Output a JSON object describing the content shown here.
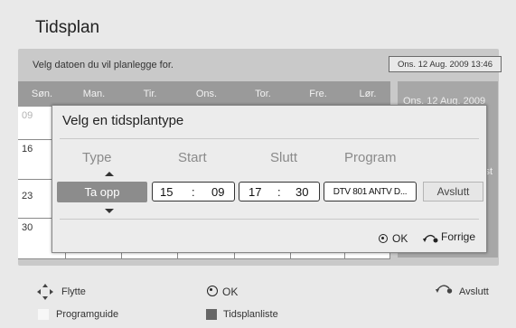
{
  "header": {
    "title": "Tidsplan"
  },
  "calendar": {
    "prompt": "Velg datoen du vil planlegge for.",
    "current_date": "Ons. 12 Aug. 2009 13:46",
    "days": [
      "Søn.",
      "Man.",
      "Tir.",
      "Ons.",
      "Tor.",
      "Fre.",
      "Lør."
    ],
    "week_starts": [
      "09",
      "16",
      "23",
      "30"
    ],
    "side_panel": {
      "date_text": "Ons. 12 Aug. 2009",
      "text": "st"
    }
  },
  "dialog": {
    "title": "Velg en tidsplantype",
    "headers": {
      "type": "Type",
      "start": "Start",
      "end": "Slutt",
      "program": "Program"
    },
    "type_value": "Ta opp",
    "start_hour": "15",
    "start_min": "09",
    "end_hour": "17",
    "end_min": "30",
    "time_separator": ":",
    "program_value": "DTV 801 ANTV D...",
    "exit_label": "Avslutt",
    "ok_label": "OK",
    "back_label": "Forrige"
  },
  "footer": {
    "move_label": "Flytte",
    "ok_label": "OK",
    "exit_label": "Avslutt",
    "guide_label": "Programguide",
    "list_label": "Tidsplanliste"
  },
  "colors": {
    "guide_square": "#f7f7f7",
    "list_square": "#666666",
    "header_gray": "#9a9a9a"
  }
}
